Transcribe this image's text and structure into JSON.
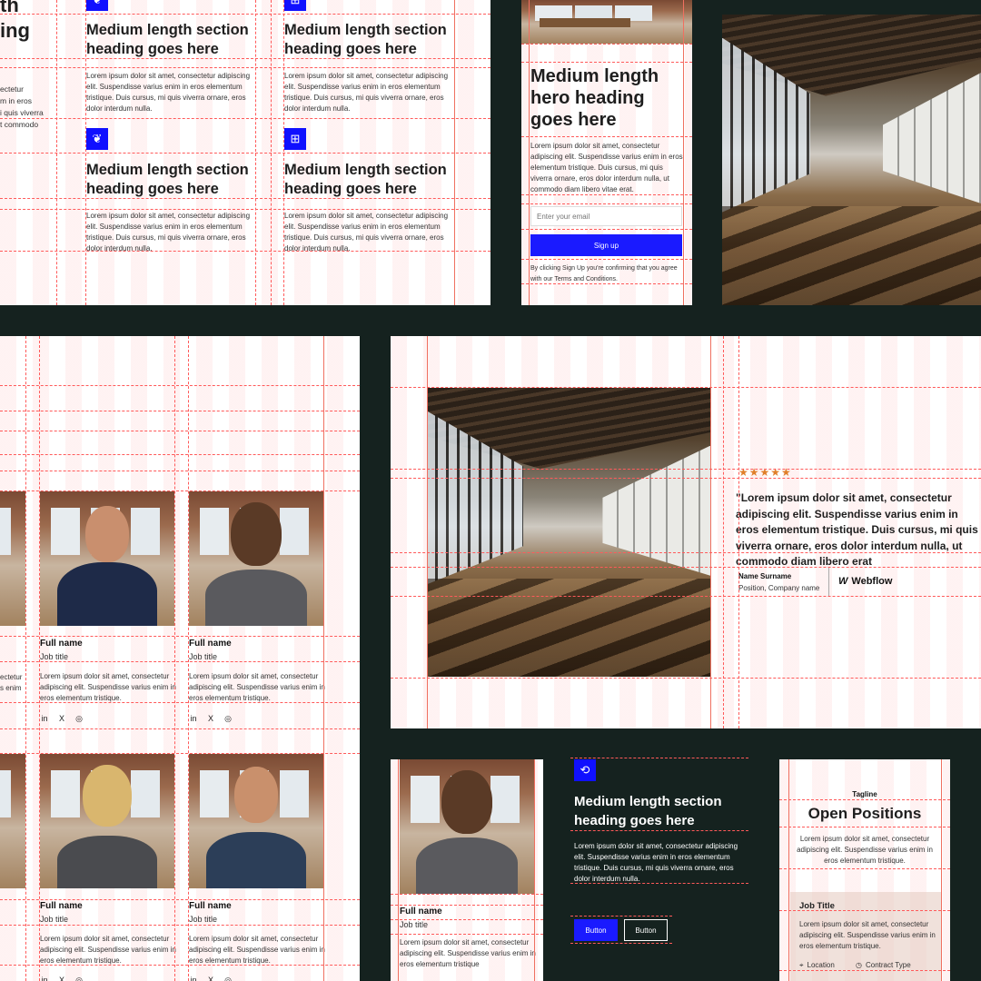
{
  "colors": {
    "background": "#15221f",
    "accent": "#1a1aff",
    "guide": "#ff5a5a",
    "star": "#e0802a"
  },
  "panel1": {
    "cut_heading": [
      "th",
      "ing"
    ],
    "cut_body": [
      "ectetur",
      "m in eros",
      "i quis viverra",
      "t commodo"
    ],
    "features": [
      {
        "icon": "leaf-icon",
        "heading": "Medium length section heading goes here",
        "body": "Lorem ipsum dolor sit amet, consectetur adipiscing elit. Suspendisse varius enim in eros elementum tristique. Duis cursus, mi quis viverra ornare, eros dolor interdum nulla."
      },
      {
        "icon": "network-icon",
        "heading": "Medium length section heading goes here",
        "body": "Lorem ipsum dolor sit amet, consectetur adipiscing elit. Suspendisse varius enim in eros elementum tristique. Duis cursus, mi quis viverra ornare, eros dolor interdum nulla."
      },
      {
        "icon": "leaf-icon",
        "heading": "Medium length section heading goes here",
        "body": "Lorem ipsum dolor sit amet, consectetur adipiscing elit. Suspendisse varius enim in eros elementum tristique. Duis cursus, mi quis viverra ornare, eros dolor interdum nulla."
      },
      {
        "icon": "network-icon",
        "heading": "Medium length section heading goes here",
        "body": "Lorem ipsum dolor sit amet, consectetur adipiscing elit. Suspendisse varius enim in eros elementum tristique. Duis cursus, mi quis viverra ornare, eros dolor interdum nulla."
      }
    ]
  },
  "hero": {
    "heading": "Medium length hero heading goes here",
    "body": "Lorem ipsum dolor sit amet, consectetur adipiscing elit. Suspendisse varius enim in eros elementum tristique. Duis cursus, mi quis viverra ornare, eros dolor interdum nulla, ut commodo diam libero vitae erat.",
    "email_placeholder": "Enter your email",
    "signup_label": "Sign up",
    "terms": "By clicking Sign Up you're confirming that you agree with our Terms and Conditions."
  },
  "team": {
    "cut_body": [
      "ectetur",
      "s enim"
    ],
    "members": [
      {
        "name": "Full name",
        "title": "Job title",
        "bio": "Lorem ipsum dolor sit amet, consectetur adipiscing elit. Suspendisse varius enim in eros elementum tristique."
      },
      {
        "name": "Full name",
        "title": "Job title",
        "bio": "Lorem ipsum dolor sit amet, consectetur adipiscing elit. Suspendisse varius enim in eros elementum tristique."
      },
      {
        "name": "Full name",
        "title": "Job title",
        "bio": "Lorem ipsum dolor sit amet, consectetur adipiscing elit. Suspendisse varius enim in eros elementum tristique."
      },
      {
        "name": "Full name",
        "title": "Job title",
        "bio": "Lorem ipsum dolor sit amet, consectetur adipiscing elit. Suspendisse varius enim in eros elementum tristique."
      }
    ],
    "social": {
      "linkedin": "in",
      "x": "X",
      "dribbble": "◎"
    }
  },
  "testimonial": {
    "stars": "★★★★★",
    "rating": 5,
    "quote": "\"Lorem ipsum dolor sit amet, consectetur adipiscing elit. Suspendisse varius enim in eros elementum tristique. Duis cursus, mi quis viverra ornare, eros dolor interdum nulla, ut commodo diam libero erat",
    "name": "Name Surname",
    "position": "Position, Company name",
    "logo": "Webflow"
  },
  "member_card": {
    "name": "Full name",
    "title": "Job title",
    "bio": "Lorem ipsum dolor sit amet, consectetur adipiscing elit. Suspendisse varius enim in eros elementum tristique"
  },
  "dark_section": {
    "heading": "Medium length section heading goes here",
    "body": "Lorem ipsum dolor sit amet, consectetur adipiscing elit. Suspendisse varius enim in eros elementum tristique. Duis cursus, mi quis viverra ornare, eros dolor interdum nulla.",
    "button_primary": "Button",
    "button_secondary": "Button"
  },
  "positions": {
    "tagline": "Tagline",
    "heading": "Open Positions",
    "body": "Lorem ipsum dolor sit amet, consectetur adipiscing elit. Suspendisse varius enim in eros elementum tristique.",
    "job_title": "Job Title",
    "job_body": "Lorem ipsum dolor sit amet, consectetur adipiscing elit. Suspendisse varius enim in eros elementum tristique.",
    "location": "Location",
    "contract": "Contract Type"
  }
}
